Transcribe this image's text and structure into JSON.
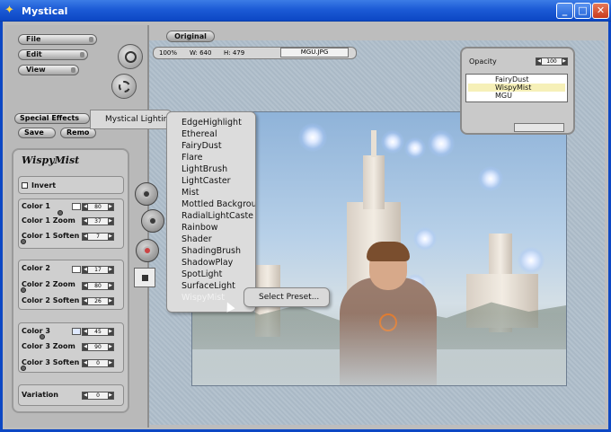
{
  "window": {
    "title": "Mystical",
    "app_icon": "mystical-logo-icon",
    "buttons": [
      "minimize-icon",
      "maximize-icon",
      "close-icon"
    ]
  },
  "menu_buttons": {
    "file": "File",
    "edit": "Edit",
    "view": "View",
    "special_effects": "Special Effects",
    "save": "Save",
    "remove": "Remo"
  },
  "toolbar": {
    "original": "Original",
    "zoom": "100%",
    "width": "W: 640",
    "height": "H: 479",
    "filename": "MGU.JPG"
  },
  "effect_panel": {
    "title": "WispyMist",
    "invert": "Invert",
    "params": [
      {
        "label": "Color 1",
        "value": "80",
        "swatch": true
      },
      {
        "label": "Color 1 Zoom",
        "value": "37"
      },
      {
        "label": "Color 1 Soften",
        "value": "7"
      },
      {
        "label": "Color 2",
        "value": "17",
        "swatch": true
      },
      {
        "label": "Color 2 Zoom",
        "value": "80"
      },
      {
        "label": "Color 2 Soften",
        "value": "26"
      },
      {
        "label": "Color 3",
        "value": "45",
        "swatch": true
      },
      {
        "label": "Color 3 Zoom",
        "value": "90"
      },
      {
        "label": "Color 3 Soften",
        "value": "0"
      },
      {
        "label": "Variation",
        "value": "0"
      }
    ]
  },
  "layers": {
    "opacity_label": "Opacity",
    "opacity_value": "100",
    "items": [
      "FairyDust",
      "WispyMist",
      "MGU"
    ],
    "selected": "WispyMist"
  },
  "context_menu": {
    "parent": "Mystical Lightin",
    "items": [
      "EdgeHighlight",
      "Ethereal",
      "FairyDust",
      "Flare",
      "LightBrush",
      "LightCaster",
      "Mist",
      "Mottled Backgrou",
      "RadialLightCaste",
      "Rainbow",
      "Shader",
      "ShadingBrush",
      "ShadowPlay",
      "SpotLight",
      "SurfaceLight",
      "WispyMist"
    ],
    "disabled": "WispyMist",
    "submenu": "Select Preset..."
  },
  "colors": {
    "titlebar": "#1c5bd6",
    "accent": "#0c47c4",
    "menu_bg": "#dcdcdc"
  }
}
